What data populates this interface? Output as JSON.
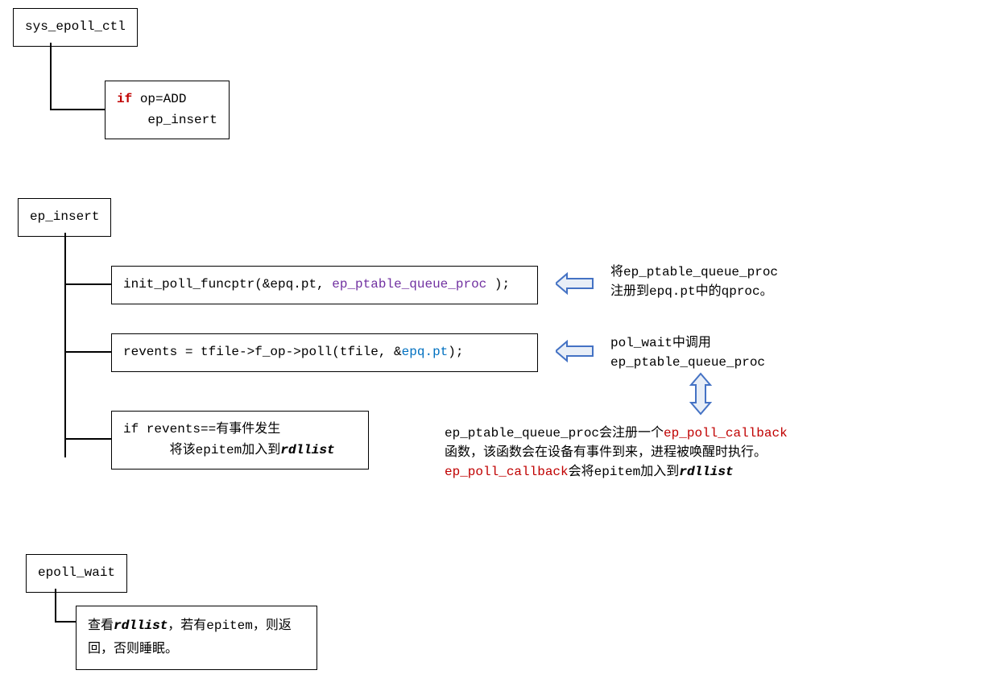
{
  "section1": {
    "title": "sys_epoll_ctl",
    "child": {
      "if_keyword": "if ",
      "condition": "op=ADD",
      "body": "ep_insert"
    }
  },
  "section2": {
    "title": "ep_insert",
    "child1": {
      "prefix": "init_poll_funcptr(&epq.pt, ",
      "purple": "ep_ptable_queue_proc",
      "suffix": " );"
    },
    "child2": {
      "prefix": "revents = tfile->f_op->poll(tfile, &",
      "blue": "epq.pt",
      "suffix": ");"
    },
    "child3": {
      "line1": "if revents==有事件发生",
      "line2_prefix": "将该epitem加入到",
      "line2_bold": "rdllist"
    }
  },
  "section3": {
    "title": "epoll_wait",
    "child": {
      "part1": "查看",
      "bold1": "rdllist",
      "part2": "，若有epitem，则返回，否则睡眠。"
    }
  },
  "annotation1": {
    "line1": "将ep_ptable_queue_proc",
    "line2": "注册到epq.pt中的qproc。"
  },
  "annotation2": {
    "line1": "pol_wait中调用",
    "line2": "ep_ptable_queue_proc"
  },
  "annotation3": {
    "part1": "ep_ptable_queue_proc会注册一个",
    "red1": "ep_poll_callback",
    "part2": "函数，该函数会在设备有事件到来，进程被唤醒时执行。",
    "red2": "ep_poll_callback",
    "part3": "会将epitem加入到",
    "bold1": "rdllist"
  }
}
